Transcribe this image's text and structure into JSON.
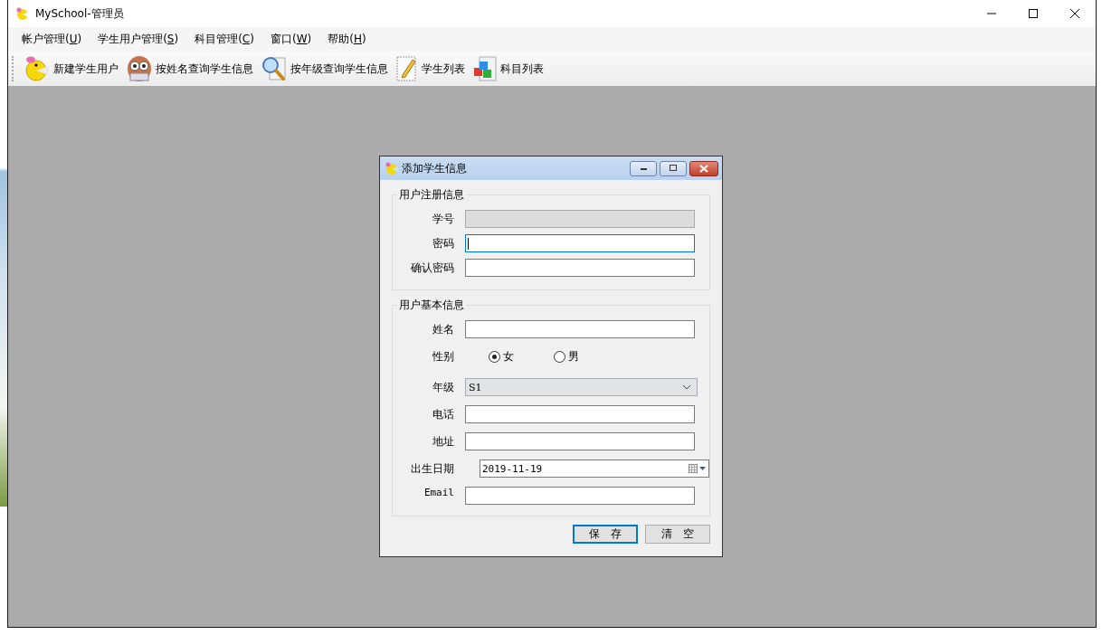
{
  "window": {
    "title": "MySchool-管理员"
  },
  "menu": [
    {
      "label": "帐户管理(U)"
    },
    {
      "label": "学生用户管理(S)"
    },
    {
      "label": "科目管理(C)"
    },
    {
      "label": "窗口(W)"
    },
    {
      "label": "帮助(H)"
    }
  ],
  "toolbar": [
    {
      "label": "新建学生用户",
      "kind": "pacman"
    },
    {
      "label": "按姓名查询学生信息",
      "kind": "owl"
    },
    {
      "label": "按年级查询学生信息",
      "kind": "magnifier"
    },
    {
      "label": "学生列表",
      "kind": "notepad"
    },
    {
      "label": "科目列表",
      "kind": "cubes"
    }
  ],
  "dialog": {
    "title": "添加学生信息",
    "groups": [
      {
        "title": "用户注册信息",
        "fields": [
          {
            "label": "学号",
            "kind": "text",
            "disabled": true,
            "focused": false
          },
          {
            "label": "密码",
            "kind": "text",
            "disabled": false,
            "focused": true
          },
          {
            "label": "确认密码",
            "kind": "text",
            "disabled": false,
            "focused": false
          }
        ]
      },
      {
        "title": "用户基本信息",
        "fields": [
          {
            "label": "姓名",
            "kind": "text",
            "disabled": false,
            "focused": false
          },
          {
            "label": "性别",
            "kind": "radio",
            "options": [
              {
                "label": "女",
                "selected": true
              },
              {
                "label": "男",
                "selected": false
              }
            ]
          },
          {
            "label": "年级",
            "kind": "select",
            "value": "S1"
          },
          {
            "label": "电话",
            "kind": "text",
            "disabled": false,
            "focused": false
          },
          {
            "label": "地址",
            "kind": "text",
            "disabled": false,
            "focused": false
          },
          {
            "label": "出生日期",
            "kind": "date",
            "value": "2019-11-19"
          },
          {
            "label": "Email",
            "kind": "text",
            "disabled": false,
            "focused": false
          }
        ]
      }
    ],
    "buttons": [
      {
        "label": "保　存",
        "default": true
      },
      {
        "label": "清　空",
        "default": false
      }
    ]
  }
}
